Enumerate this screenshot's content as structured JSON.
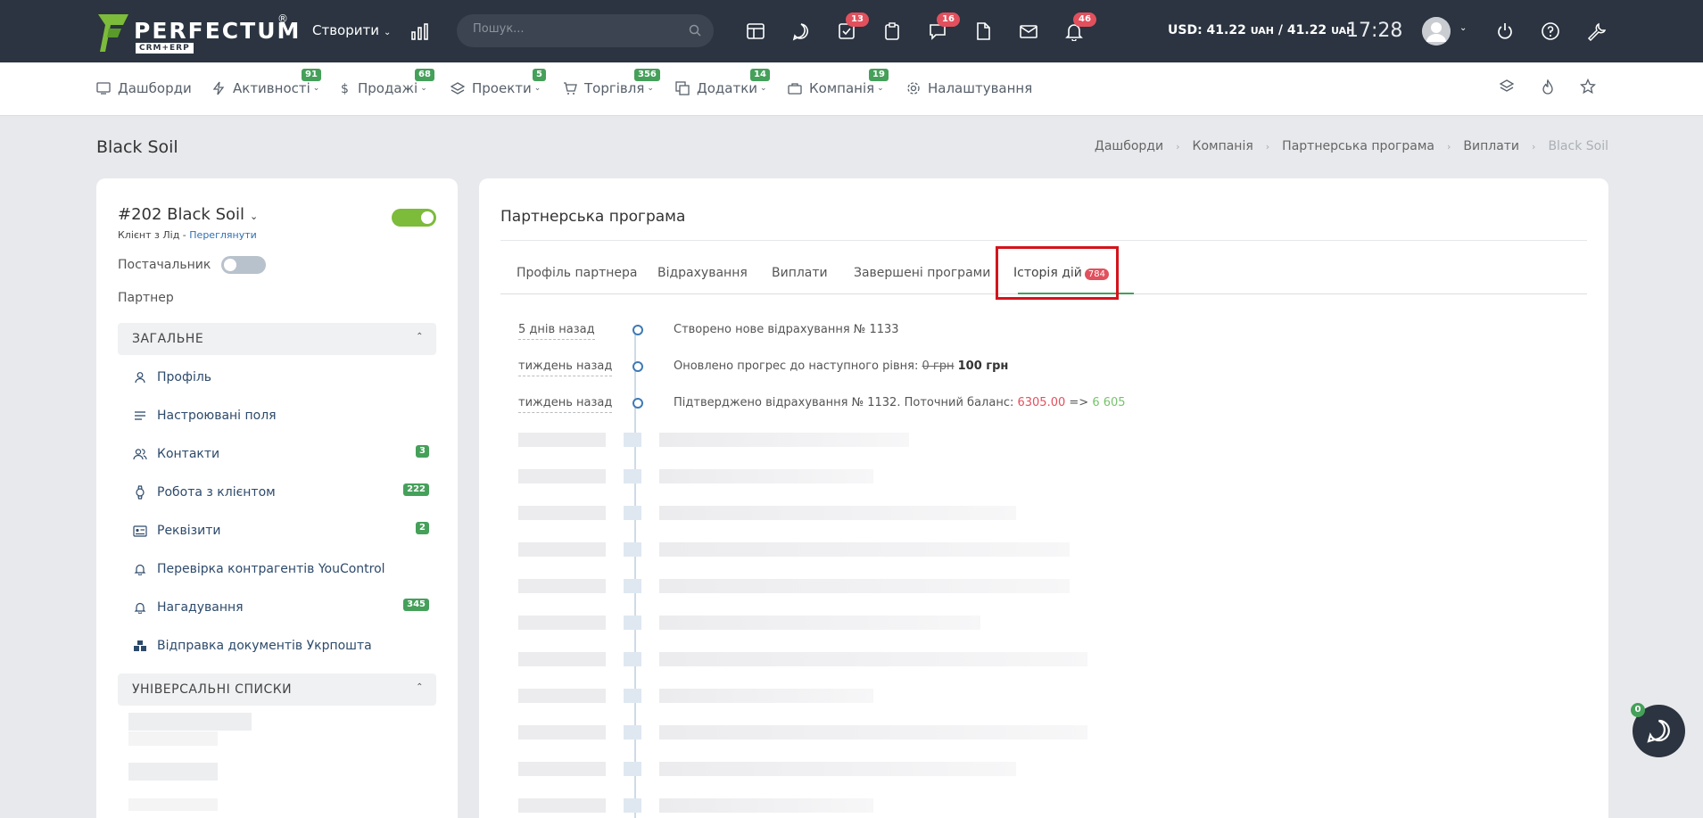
{
  "topbar": {
    "logo_text": "PERFECTUM",
    "logo_sub": "CRM+ERP",
    "logo_reg": "®",
    "create_label": "Створити",
    "search_placeholder": "Пошук...",
    "badges": {
      "tasks": "13",
      "chat": "16",
      "notifications": "46"
    },
    "currency": "USD: 41.22",
    "currency_unit1": "UAH",
    "currency_mid": " / 41.22 ",
    "currency_unit2": "UAH",
    "time": "17:28"
  },
  "nav": {
    "items": [
      {
        "label": "Дашборди",
        "badge": ""
      },
      {
        "label": "Активності",
        "badge": "91"
      },
      {
        "label": "Продажі",
        "badge": "68"
      },
      {
        "label": "Проекти",
        "badge": "5"
      },
      {
        "label": "Торгівля",
        "badge": "356"
      },
      {
        "label": "Додатки",
        "badge": "14"
      },
      {
        "label": "Компанія",
        "badge": "19"
      },
      {
        "label": "Налаштування",
        "badge": ""
      }
    ]
  },
  "page": {
    "title": "Black Soil",
    "breadcrumb": [
      "Дашборди",
      "Компанія",
      "Партнерська програма",
      "Виплати",
      "Black Soil"
    ]
  },
  "client": {
    "name": "#202 Black Soil",
    "sub_prefix": "Клієнт з Лід - ",
    "sub_link": "Переглянути",
    "supplier_label": "Постачальник",
    "partner_label": "Партнер",
    "section_general": "ЗАГАЛЬНЕ",
    "section_lists": "УНІВЕРСАЛЬНІ СПИСКИ",
    "menu": [
      {
        "label": "Профіль",
        "badge": ""
      },
      {
        "label": "Настроювані поля",
        "badge": ""
      },
      {
        "label": "Контакти",
        "badge": "3"
      },
      {
        "label": "Робота з клієнтом",
        "badge": "222"
      },
      {
        "label": "Реквізити",
        "badge": "2"
      },
      {
        "label": "Перевірка контрагентів YouControl",
        "badge": ""
      },
      {
        "label": "Нагадування",
        "badge": "345"
      },
      {
        "label": "Відправка документів Укрпошта",
        "badge": ""
      }
    ]
  },
  "main": {
    "title": "Партнерська програма",
    "tabs": [
      {
        "label": "Профіль партнера"
      },
      {
        "label": "Відрахування"
      },
      {
        "label": "Виплати"
      },
      {
        "label": "Завершені програми"
      },
      {
        "label": "Історія дій",
        "badge": "784"
      }
    ],
    "timeline": [
      {
        "time": "5 днів назад",
        "text": "Створено нове відрахування № 1133"
      },
      {
        "time": "тиждень назад",
        "text_prefix": "Оновлено прогрес до наступного рівня: ",
        "old_value": "0 грн",
        "new_value": "100 грн"
      },
      {
        "time": "тиждень назад",
        "text_prefix": "Підтверджено відрахування № 1132. Поточний баланс: ",
        "old_balance": "6305.00",
        "arrow": " => ",
        "new_balance": "6 605"
      }
    ]
  },
  "chat": {
    "badge": "0"
  },
  "colors": {
    "topbar": "#2b3440",
    "accent_green": "#45a05a",
    "badge_red": "#e2505d",
    "link_blue": "#2f6fb3",
    "highlight_red": "#d4141c"
  }
}
